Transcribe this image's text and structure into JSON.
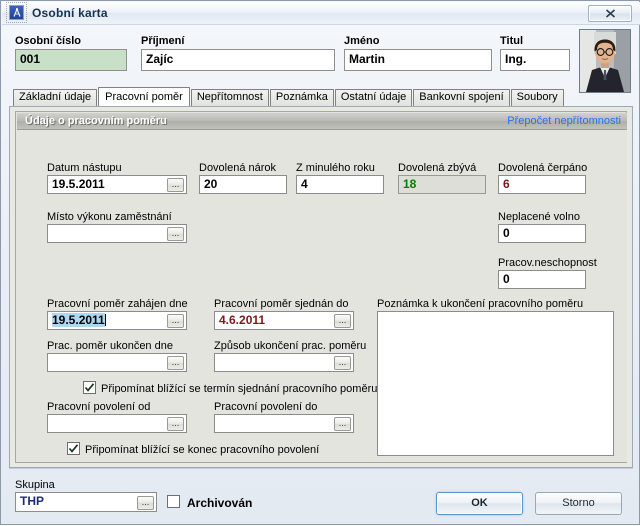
{
  "window": {
    "title": "Osobní karta",
    "icon": "app-icon",
    "close_label": "✕"
  },
  "header": {
    "fields": [
      {
        "label": "Osobní číslo",
        "value": "001",
        "readonly": true
      },
      {
        "label": "Příjmení",
        "value": "Zajíc",
        "readonly": false
      },
      {
        "label": "Jméno",
        "value": "Martin",
        "readonly": false
      },
      {
        "label": "Titul",
        "value": "Ing.",
        "readonly": false
      }
    ],
    "photo_alt": "employee-photo"
  },
  "tabs": [
    {
      "label": "Základní údaje",
      "active": false
    },
    {
      "label": "Pracovní poměr",
      "active": true
    },
    {
      "label": "Nepřítomnost",
      "active": false
    },
    {
      "label": "Poznámka",
      "active": false
    },
    {
      "label": "Ostatní údaje",
      "active": false
    },
    {
      "label": "Bankovní spojení",
      "active": false
    },
    {
      "label": "Soubory",
      "active": false
    }
  ],
  "group": {
    "title": "Údaje o pracovním poměru",
    "link": "Přepočet nepřítomnosti"
  },
  "form": {
    "datum_nastupu": {
      "label": "Datum nástupu",
      "value": "19.5.2011",
      "ellipsis": "..."
    },
    "dovolena_narok": {
      "label": "Dovolená nárok",
      "value": "20"
    },
    "z_minuleho_roku": {
      "label": "Z minulého roku",
      "value": "4"
    },
    "dovolena_zbyva": {
      "label": "Dovolená zbývá",
      "value": "18"
    },
    "dovolena_cerpano": {
      "label": "Dovolená čerpáno",
      "value": "6"
    },
    "misto_vykonu": {
      "label": "Místo výkonu zaměstnání",
      "value": "",
      "ellipsis": "..."
    },
    "neplacene_volno": {
      "label": "Neplacené volno",
      "value": "0"
    },
    "pracov_neschopnost": {
      "label": "Pracov.neschopnost",
      "value": "0"
    },
    "pp_zahajen": {
      "label": "Pracovní poměr zahájen dne",
      "value": "19.5.2011",
      "ellipsis": "..."
    },
    "pp_sjednan_do": {
      "label": "Pracovní poměr sjednán do",
      "value": "4.6.2011",
      "ellipsis": "..."
    },
    "pp_ukoncen": {
      "label": "Prac. poměr ukončen dne",
      "value": "",
      "ellipsis": "..."
    },
    "zpusob_ukonceni": {
      "label": "Způsob ukončení prac. poměru",
      "value": "",
      "ellipsis": "..."
    },
    "poznamka_ukonceni": {
      "label": "Poznámka k ukončení pracovního poměru",
      "value": ""
    },
    "check_termin": {
      "label": "Připomínat blížící se termín sjednání pracovního poměru",
      "checked": true
    },
    "povoleni_od": {
      "label": "Pracovní povolení od",
      "value": "",
      "ellipsis": "..."
    },
    "povoleni_do": {
      "label": "Pracovní povolení do",
      "value": "",
      "ellipsis": "..."
    },
    "check_povoleni": {
      "label": "Připomínat blížící se konec pracovního povolení",
      "checked": true
    }
  },
  "footer": {
    "skupina_label": "Skupina",
    "skupina_value": "THP",
    "skupina_ellipsis": "...",
    "archivovan_label": "Archivován",
    "archivovan_checked": false,
    "ok_label": "OK",
    "storno_label": "Storno"
  },
  "colors": {
    "accent_link": "#2a6ff0",
    "value_green": "#008000",
    "value_red": "#7d1919",
    "value_navy": "#1e2c78",
    "readonly_green_bg": "#c8e0c8",
    "window_bg": "#e4e4de"
  }
}
